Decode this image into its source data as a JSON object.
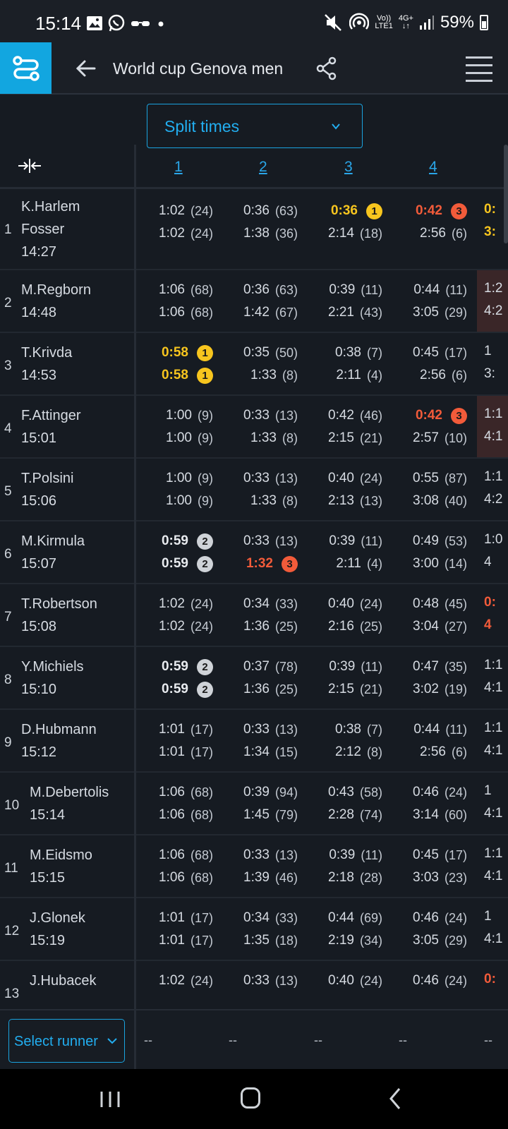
{
  "status_bar": {
    "time": "15:14",
    "network_top": "Vo))",
    "network_bottom": "LTE1",
    "signal_top": "4G+",
    "battery": "59%"
  },
  "header": {
    "title": "World cup Genova men"
  },
  "view_selector": {
    "label": "Split times"
  },
  "columns": [
    "1",
    "2",
    "3",
    "4"
  ],
  "rows": [
    {
      "rank": "1",
      "name_line1": "K.Harlem",
      "name_line2": "Fosser",
      "start": "14:27",
      "splits": [
        {
          "leg": "1:02",
          "leg_pos": "(24)",
          "cum": "1:02",
          "cum_pos": "(24)"
        },
        {
          "leg": "0:36",
          "leg_pos": "(63)",
          "cum": "1:38",
          "cum_pos": "(36)"
        },
        {
          "leg": "0:36",
          "leg_badge": "1",
          "leg_style": "gold",
          "cum": "2:14",
          "cum_pos": "(18)"
        },
        {
          "leg": "0:42",
          "leg_badge": "3",
          "leg_style": "red",
          "cum": "2:56",
          "cum_pos": "(6)"
        }
      ],
      "next_leg": "0:",
      "next_cum": "3:",
      "next_style": "gold"
    },
    {
      "rank": "2",
      "name_line1": "M.Regborn",
      "start": "14:48",
      "splits": [
        {
          "leg": "1:06",
          "leg_pos": "(68)",
          "cum": "1:06",
          "cum_pos": "(68)"
        },
        {
          "leg": "0:36",
          "leg_pos": "(63)",
          "cum": "1:42",
          "cum_pos": "(67)"
        },
        {
          "leg": "0:39",
          "leg_pos": "(11)",
          "cum": "2:21",
          "cum_pos": "(43)"
        },
        {
          "leg": "0:44",
          "leg_pos": "(11)",
          "cum": "3:05",
          "cum_pos": "(29)"
        }
      ],
      "next_leg": "1:2",
      "next_cum": "4:2",
      "next_bg": "red"
    },
    {
      "rank": "3",
      "name_line1": "T.Krivda",
      "start": "14:53",
      "splits": [
        {
          "leg": "0:58",
          "leg_badge": "1",
          "leg_style": "gold",
          "cum": "0:58",
          "cum_badge": "1",
          "cum_style": "gold"
        },
        {
          "leg": "0:35",
          "leg_pos": "(50)",
          "cum": "1:33",
          "cum_pos": "(8)"
        },
        {
          "leg": "0:38",
          "leg_pos": "(7)",
          "cum": "2:11",
          "cum_pos": "(4)"
        },
        {
          "leg": "0:45",
          "leg_pos": "(17)",
          "cum": "2:56",
          "cum_pos": "(6)"
        }
      ],
      "next_leg": " 1",
      "next_cum": " 3:"
    },
    {
      "rank": "4",
      "name_line1": "F.Attinger",
      "start": "15:01",
      "splits": [
        {
          "leg": "1:00",
          "leg_pos": "(9)",
          "cum": "1:00",
          "cum_pos": "(9)"
        },
        {
          "leg": "0:33",
          "leg_pos": "(13)",
          "cum": "1:33",
          "cum_pos": "(8)"
        },
        {
          "leg": "0:42",
          "leg_pos": "(46)",
          "cum": "2:15",
          "cum_pos": "(21)"
        },
        {
          "leg": "0:42",
          "leg_badge": "3",
          "leg_style": "red",
          "cum": "2:57",
          "cum_pos": "(10)"
        }
      ],
      "next_leg": "1:1",
      "next_cum": "4:1",
      "next_bg": "red"
    },
    {
      "rank": "5",
      "name_line1": "T.Polsini",
      "start": "15:06",
      "splits": [
        {
          "leg": "1:00",
          "leg_pos": "(9)",
          "cum": "1:00",
          "cum_pos": "(9)"
        },
        {
          "leg": "0:33",
          "leg_pos": "(13)",
          "cum": "1:33",
          "cum_pos": "(8)"
        },
        {
          "leg": "0:40",
          "leg_pos": "(24)",
          "cum": "2:13",
          "cum_pos": "(13)"
        },
        {
          "leg": "0:55",
          "leg_pos": "(87)",
          "cum": "3:08",
          "cum_pos": "(40)"
        }
      ],
      "next_leg": "1:1",
      "next_cum": "4:2"
    },
    {
      "rank": "6",
      "name_line1": "M.Kirmula",
      "start": "15:07",
      "splits": [
        {
          "leg": "0:59",
          "leg_badge": "2",
          "leg_style": "silver",
          "cum": "0:59",
          "cum_badge": "2",
          "cum_style": "silver"
        },
        {
          "leg": "0:33",
          "leg_pos": "(13)",
          "cum": "1:32",
          "cum_badge": "3",
          "cum_style": "red"
        },
        {
          "leg": "0:39",
          "leg_pos": "(11)",
          "cum": "2:11",
          "cum_pos": "(4)"
        },
        {
          "leg": "0:49",
          "leg_pos": "(53)",
          "cum": "3:00",
          "cum_pos": "(14)"
        }
      ],
      "next_leg": "1:0",
      "next_cum": " 4"
    },
    {
      "rank": "7",
      "name_line1": "T.Robertson",
      "start": "15:08",
      "splits": [
        {
          "leg": "1:02",
          "leg_pos": "(24)",
          "cum": "1:02",
          "cum_pos": "(24)"
        },
        {
          "leg": "0:34",
          "leg_pos": "(33)",
          "cum": "1:36",
          "cum_pos": "(25)"
        },
        {
          "leg": "0:40",
          "leg_pos": "(24)",
          "cum": "2:16",
          "cum_pos": "(25)"
        },
        {
          "leg": "0:48",
          "leg_pos": "(45)",
          "cum": "3:04",
          "cum_pos": "(27)"
        }
      ],
      "next_leg": "0:",
      "next_cum": " 4",
      "next_style": "red"
    },
    {
      "rank": "8",
      "name_line1": "Y.Michiels",
      "start": "15:10",
      "splits": [
        {
          "leg": "0:59",
          "leg_badge": "2",
          "leg_style": "silver",
          "cum": "0:59",
          "cum_badge": "2",
          "cum_style": "silver"
        },
        {
          "leg": "0:37",
          "leg_pos": "(78)",
          "cum": "1:36",
          "cum_pos": "(25)"
        },
        {
          "leg": "0:39",
          "leg_pos": "(11)",
          "cum": "2:15",
          "cum_pos": "(21)"
        },
        {
          "leg": "0:47",
          "leg_pos": "(35)",
          "cum": "3:02",
          "cum_pos": "(19)"
        }
      ],
      "next_leg": "1:1",
      "next_cum": "4:1"
    },
    {
      "rank": "9",
      "name_line1": "D.Hubmann",
      "start": "15:12",
      "splits": [
        {
          "leg": "1:01",
          "leg_pos": "(17)",
          "cum": "1:01",
          "cum_pos": "(17)"
        },
        {
          "leg": "0:33",
          "leg_pos": "(13)",
          "cum": "1:34",
          "cum_pos": "(15)"
        },
        {
          "leg": "0:38",
          "leg_pos": "(7)",
          "cum": "2:12",
          "cum_pos": "(8)"
        },
        {
          "leg": "0:44",
          "leg_pos": "(11)",
          "cum": "2:56",
          "cum_pos": "(6)"
        }
      ],
      "next_leg": "1:1",
      "next_cum": "4:1"
    },
    {
      "rank": "10",
      "name_line1": "M.Debertolis",
      "start": "15:14",
      "splits": [
        {
          "leg": "1:06",
          "leg_pos": "(68)",
          "cum": "1:06",
          "cum_pos": "(68)"
        },
        {
          "leg": "0:39",
          "leg_pos": "(94)",
          "cum": "1:45",
          "cum_pos": "(79)"
        },
        {
          "leg": "0:43",
          "leg_pos": "(58)",
          "cum": "2:28",
          "cum_pos": "(74)"
        },
        {
          "leg": "0:46",
          "leg_pos": "(24)",
          "cum": "3:14",
          "cum_pos": "(60)"
        }
      ],
      "next_leg": " 1",
      "next_cum": "4:1"
    },
    {
      "rank": "11",
      "name_line1": "M.Eidsmo",
      "start": "15:15",
      "splits": [
        {
          "leg": "1:06",
          "leg_pos": "(68)",
          "cum": "1:06",
          "cum_pos": "(68)"
        },
        {
          "leg": "0:33",
          "leg_pos": "(13)",
          "cum": "1:39",
          "cum_pos": "(46)"
        },
        {
          "leg": "0:39",
          "leg_pos": "(11)",
          "cum": "2:18",
          "cum_pos": "(28)"
        },
        {
          "leg": "0:45",
          "leg_pos": "(17)",
          "cum": "3:03",
          "cum_pos": "(23)"
        }
      ],
      "next_leg": "1:1",
      "next_cum": "4:1"
    },
    {
      "rank": "12",
      "name_line1": "J.Glonek",
      "start": "15:19",
      "splits": [
        {
          "leg": "1:01",
          "leg_pos": "(17)",
          "cum": "1:01",
          "cum_pos": "(17)"
        },
        {
          "leg": "0:34",
          "leg_pos": "(33)",
          "cum": "1:35",
          "cum_pos": "(18)"
        },
        {
          "leg": "0:44",
          "leg_pos": "(69)",
          "cum": "2:19",
          "cum_pos": "(34)"
        },
        {
          "leg": "0:46",
          "leg_pos": "(24)",
          "cum": "3:05",
          "cum_pos": "(29)"
        }
      ],
      "next_leg": " 1",
      "next_cum": "4:1"
    },
    {
      "rank": "13",
      "name_line1": "J.Hubacek",
      "start": "",
      "splits": [
        {
          "leg": "1:02",
          "leg_pos": "(24)",
          "cum": "",
          "cum_pos": ""
        },
        {
          "leg": "0:33",
          "leg_pos": "(13)",
          "cum": "",
          "cum_pos": ""
        },
        {
          "leg": "0:40",
          "leg_pos": "(24)",
          "cum": "",
          "cum_pos": ""
        },
        {
          "leg": "0:46",
          "leg_pos": "(24)",
          "cum": "",
          "cum_pos": ""
        }
      ],
      "next_leg": "0:",
      "next_cum": "",
      "next_style": "red"
    }
  ],
  "footer": {
    "select_runner": "Select runner",
    "dashes": [
      "--",
      "--",
      "--",
      "--",
      "--"
    ]
  },
  "colors": {
    "accent": "#12a6e0",
    "gold": "#f7c51e",
    "red": "#f25b3a",
    "silver": "#cfd3d8",
    "background": "#161b22"
  }
}
